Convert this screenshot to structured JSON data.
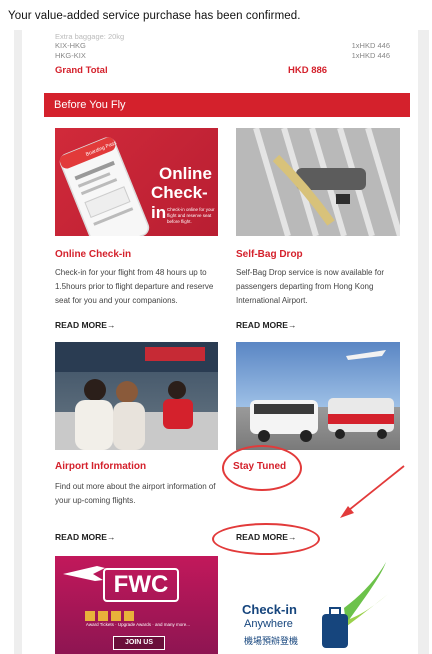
{
  "notification": "Your value-added service purchase has been confirmed.",
  "summary": {
    "cut_row": "Extra baggage: 20kg",
    "rows": [
      {
        "route": "KIX-HKG",
        "amount": "1xHKD 446"
      },
      {
        "route": "HKG-KIX",
        "amount": "1xHKD 446"
      }
    ],
    "grand_total_label": "Grand Total",
    "grand_total_value": "HKD 886"
  },
  "section_title": "Before You Fly",
  "cards": [
    {
      "title": "Online Check-in",
      "desc": "Check-in for your flight from 48 hours up to 1.5hours prior to flight departure and reserve seat for you and your companions.",
      "read_more": "READ MORE→",
      "image": {
        "headline_1": "Online",
        "headline_2": "Check-in",
        "caption": "Check-in online for your flight and reserve seat before flight.",
        "phone_label": "Boarding Pass"
      }
    },
    {
      "title": "Self-Bag Drop",
      "desc": "Self-Bag Drop service is now available for passengers departing from Hong Kong International Airport.",
      "read_more": "READ MORE→"
    },
    {
      "title": "Airport Information",
      "desc": "Find out more about the airport information of your up-coming flights.",
      "read_more": "READ MORE→"
    },
    {
      "title": "Stay Tuned",
      "desc": "",
      "read_more": "READ MORE→"
    }
  ],
  "promo_fwc": {
    "logo": "FWC",
    "subtitle": "Award Tickets · Upgrade Awards · and many more...",
    "button": "JOIN US"
  },
  "promo_checkin": {
    "line1": "Check-in",
    "line2": "Anywhere",
    "line3": "機場預辦登機"
  },
  "colors": {
    "brand_red": "#d4212c",
    "annotation_red": "#e23a3a",
    "page_grey": "#eeeeee"
  }
}
